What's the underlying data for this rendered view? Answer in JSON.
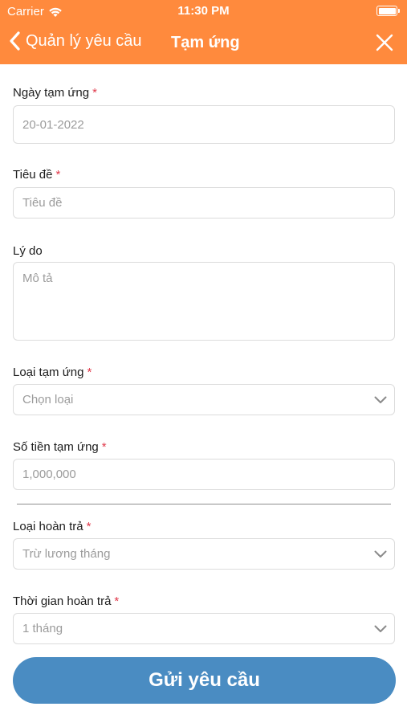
{
  "status_bar": {
    "carrier": "Carrier",
    "time": "11:30 PM"
  },
  "navbar": {
    "back_label": "Quản lý yêu cầu",
    "title": "Tạm ứng"
  },
  "form": {
    "date": {
      "label": "Ngày tạm ứng",
      "required": "*",
      "value": "20-01-2022"
    },
    "title": {
      "label": "Tiêu đề",
      "required": "*",
      "placeholder": "Tiêu đề"
    },
    "reason": {
      "label": "Lý do",
      "placeholder": "Mô tả"
    },
    "type": {
      "label": "Loại tạm ứng",
      "required": "*",
      "placeholder": "Chọn loại"
    },
    "amount": {
      "label": "Số tiền tạm ứng",
      "required": "*",
      "placeholder": "1,000,000"
    },
    "repay_type": {
      "label": "Loại hoàn trả",
      "required": "*",
      "value": "Trừ lương tháng"
    },
    "repay_time": {
      "label": "Thời gian hoàn trả",
      "required": "*",
      "value": "1 tháng"
    }
  },
  "submit_label": "Gửi yêu cầu",
  "colors": {
    "header": "#FF8A3D",
    "button": "#4A8CC2",
    "required": "#E0394A"
  }
}
